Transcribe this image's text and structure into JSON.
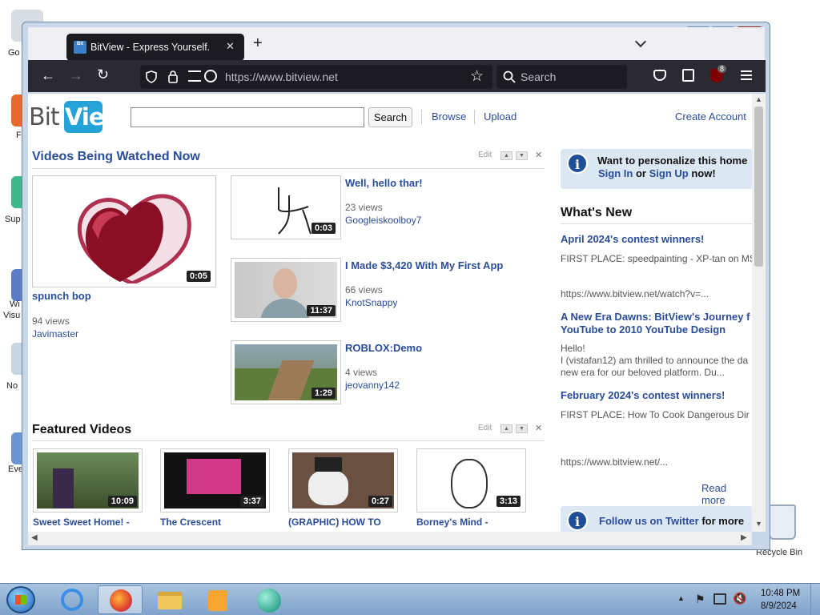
{
  "desktop": {
    "icon_labels": [
      "Go",
      "F",
      "Sup",
      "Wi",
      "Visu",
      "No",
      "Eve"
    ],
    "recycle_label": "Recycle Bin"
  },
  "browser": {
    "tab_title": "BitView - Express Yourself.",
    "tab_icon_text": "Bit",
    "url": "https://www.bitview.net",
    "search_placeholder": "Search",
    "extension_badge": "8"
  },
  "site": {
    "logo_left": "Bit",
    "logo_right": "View",
    "search_button": "Search",
    "nav_browse": "Browse",
    "nav_upload": "Upload",
    "create_account": "Create Account",
    "edit_label": "Edit",
    "watched_title": "Videos Being Watched Now",
    "featured_title": "Featured Videos",
    "main_video": {
      "title": "spunch bop",
      "views": "94 views",
      "user": "Javimaster",
      "duration": "0:05"
    },
    "side_videos": [
      {
        "title": "Well, hello thar!",
        "views": "23 views",
        "user": "Googleiskoolboy7",
        "duration": "0:03"
      },
      {
        "title": "I Made $3,420 With My First App",
        "views": "66 views",
        "user": "KnotSnappy",
        "duration": "11:37"
      },
      {
        "title": "ROBLOX:Demo",
        "views": "4 views",
        "user": "jeovanny142",
        "duration": "1:29"
      }
    ],
    "featured": [
      {
        "title": "Sweet Sweet Home! -",
        "duration": "10:09"
      },
      {
        "title": "The Crescent",
        "duration": "3:37"
      },
      {
        "title": "(GRAPHIC) HOW TO",
        "duration": "0:27"
      },
      {
        "title": "Borney's Mind -",
        "duration": "3:13"
      }
    ],
    "personalize": {
      "line1": "Want to personalize this home",
      "sign_in": "Sign In",
      "or": "or",
      "sign_up": "Sign Up",
      "now": "now!"
    },
    "whats_new_title": "What's New",
    "news": [
      {
        "title": "April 2024's contest winners!",
        "body": "FIRST PLACE: speedpainting - XP-tan on MS",
        "link": "https://www.bitview.net/watch?v=..."
      },
      {
        "title": "A New Era Dawns: BitView's Journey f",
        "title2": "YouTube to 2010 YouTube Design",
        "body1": "Hello!",
        "body2": "I (vistafan12) am thrilled to announce the da",
        "body3": "new era for our beloved platform. Du..."
      },
      {
        "title": "February 2024's contest winners!",
        "body": "FIRST PLACE: How To Cook Dangerous Dir",
        "link": "https://www.bitview.net/..."
      }
    ],
    "read_more": "Read more",
    "twitter": {
      "link": "Follow us on Twitter",
      "rest": "for more"
    }
  },
  "taskbar": {
    "time": "10:48 PM",
    "date": "8/9/2024"
  },
  "colors": {
    "link": "#2a4d9a",
    "accent_logo": "#23a3d8",
    "toolbar": "#2b2a33"
  }
}
